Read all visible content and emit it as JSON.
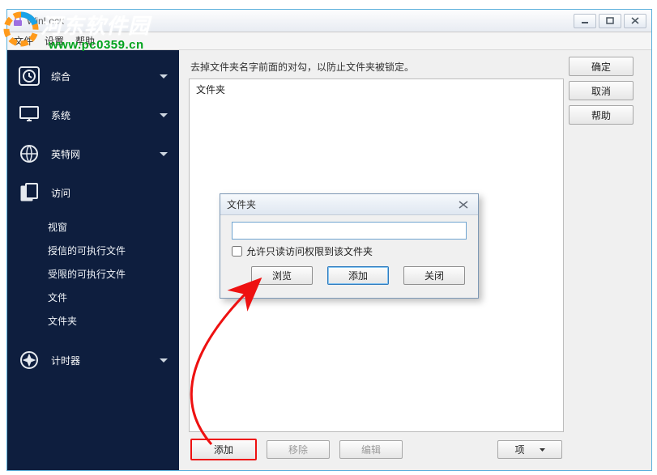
{
  "window": {
    "title": "WinLock"
  },
  "menubar": {
    "items": [
      "文件",
      "设置",
      "帮助"
    ]
  },
  "sidebar": {
    "cats": [
      {
        "label": "综合"
      },
      {
        "label": "系统"
      },
      {
        "label": "英特网"
      },
      {
        "label": "访问",
        "subs": [
          "视窗",
          "授信的可执行文件",
          "受限的可执行文件",
          "文件",
          "文件夹"
        ]
      },
      {
        "label": "计时器"
      }
    ]
  },
  "main": {
    "hint": "去掉文件夹名字前面的对勾，以防止文件夹被锁定。",
    "list_header": "文件夹",
    "btn_add": "添加",
    "btn_remove": "移除",
    "btn_edit": "编辑",
    "btn_item": "项"
  },
  "right": {
    "ok": "确定",
    "cancel": "取消",
    "help": "帮助"
  },
  "dialog": {
    "title": "文件夹",
    "input_value": "",
    "chk_label": "允许只读访问权限到该文件夹",
    "browse": "浏览",
    "add": "添加",
    "close": "关闭"
  },
  "watermark": {
    "line1": "河东软件园",
    "line2": "www.pc0359.cn"
  }
}
